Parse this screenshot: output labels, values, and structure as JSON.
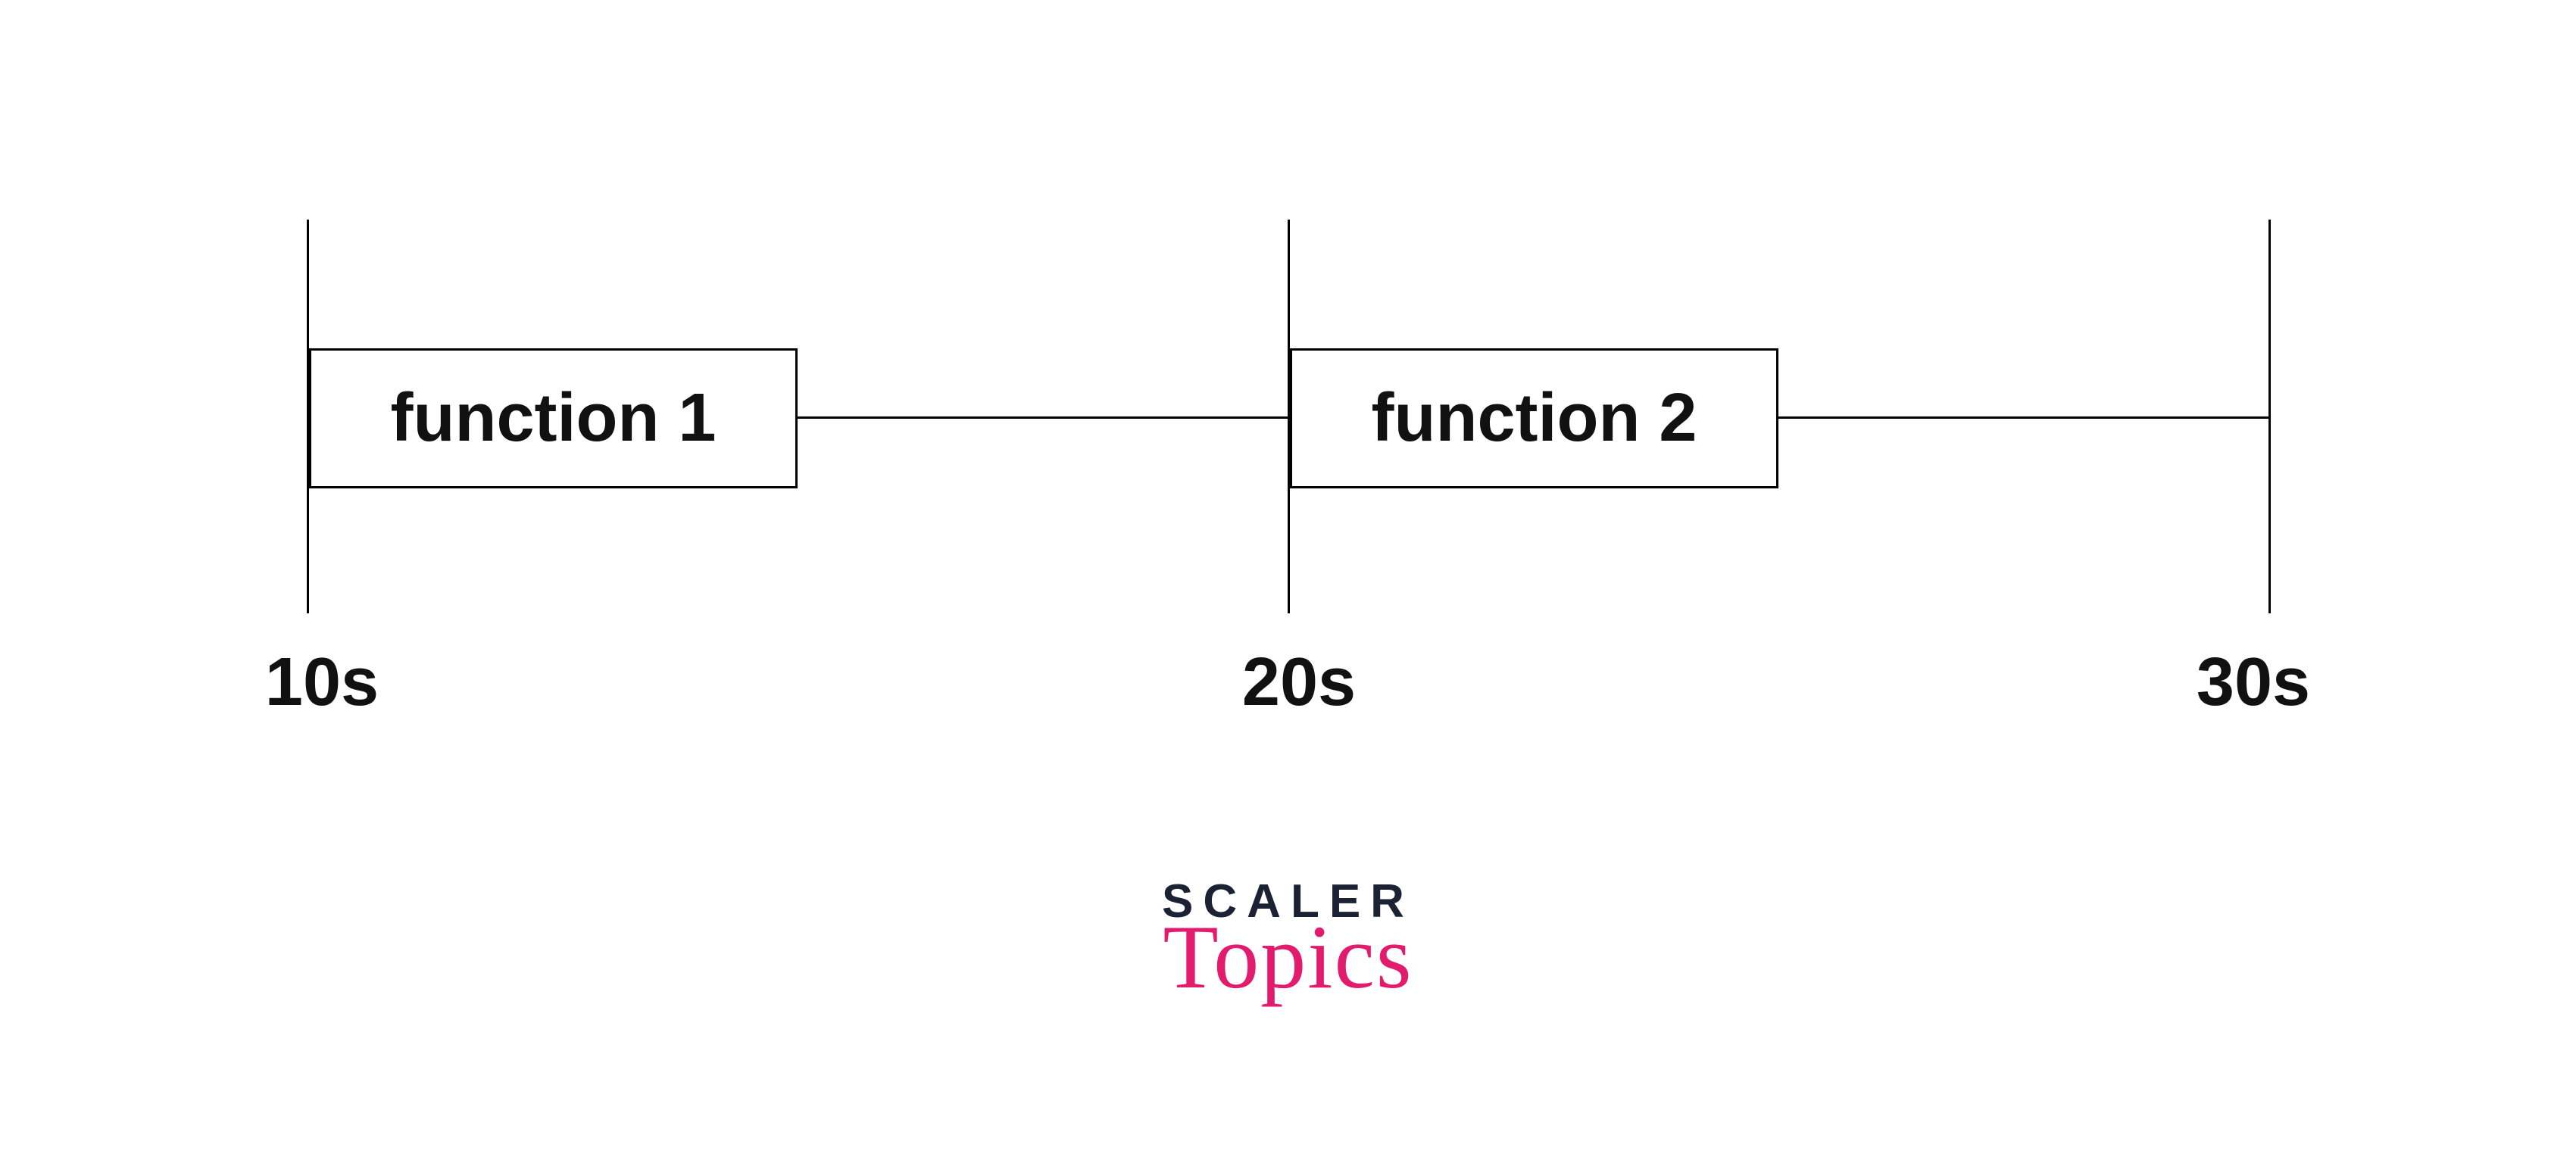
{
  "chart_data": {
    "type": "timeline",
    "unit": "s",
    "ticks": [
      {
        "value": 10,
        "label": "10s"
      },
      {
        "value": 20,
        "label": "20s"
      },
      {
        "value": 30,
        "label": "30s"
      }
    ],
    "events": [
      {
        "name": "function 1",
        "start": 10,
        "end": 15
      },
      {
        "name": "function 2",
        "start": 20,
        "end": 25
      }
    ],
    "xrange": [
      10,
      30
    ]
  },
  "logo": {
    "line1": "SCALER",
    "line2": "Topics"
  },
  "colors": {
    "text": "#111111",
    "logo_dark": "#1a2234",
    "logo_accent": "#e31b6d"
  }
}
